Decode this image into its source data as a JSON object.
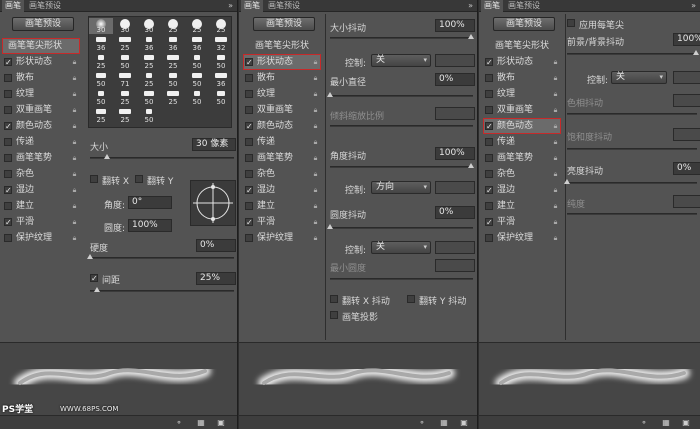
{
  "panel1": {
    "tabs": [
      "画笔",
      "画笔预设"
    ],
    "menu_icon": "»",
    "preset_button": "画笔预设",
    "list": [
      {
        "label": "画笔笔尖形状",
        "checked": false,
        "lock": false
      },
      {
        "label": "形状动态",
        "checked": true,
        "lock": true
      },
      {
        "label": "散布",
        "checked": false,
        "lock": true
      },
      {
        "label": "纹理",
        "checked": false,
        "lock": true
      },
      {
        "label": "双重画笔",
        "checked": false,
        "lock": true
      },
      {
        "label": "颜色动态",
        "checked": true,
        "lock": true
      },
      {
        "label": "传递",
        "checked": false,
        "lock": true
      },
      {
        "label": "画笔笔势",
        "checked": false,
        "lock": true
      },
      {
        "label": "杂色",
        "checked": false,
        "lock": true
      },
      {
        "label": "湿边",
        "checked": true,
        "lock": true
      },
      {
        "label": "建立",
        "checked": false,
        "lock": true
      },
      {
        "label": "平滑",
        "checked": true,
        "lock": true
      },
      {
        "label": "保护纹理",
        "checked": false,
        "lock": true
      }
    ],
    "brush_sizes": [
      "30",
      "30",
      "30",
      "25",
      "25",
      "25",
      "36",
      "25",
      "36",
      "36",
      "36",
      "32",
      "25",
      "50",
      "25",
      "25",
      "50",
      "50",
      "50",
      "71",
      "25",
      "50",
      "50",
      "36",
      "50",
      "25",
      "50",
      "25",
      "50",
      "50",
      "25",
      "25",
      "50"
    ],
    "size_label": "大小",
    "size_value": "30 像素",
    "flip_x_label": "翻转 X",
    "flip_y_label": "翻转 Y",
    "angle_label": "角度:",
    "angle_value": "0°",
    "roundness_label": "圆度:",
    "roundness_value": "100%",
    "hardness_label": "硬度",
    "hardness_value": "0%",
    "spacing_label": "间距",
    "spacing_value": "25%"
  },
  "panel2": {
    "tabs": [
      "画笔",
      "画笔预设"
    ],
    "menu_icon": "»",
    "preset_button": "画笔预设",
    "list": [
      {
        "label": "画笔笔尖形状",
        "checked": false,
        "lock": false
      },
      {
        "label": "形状动态",
        "checked": true,
        "lock": true
      },
      {
        "label": "散布",
        "checked": false,
        "lock": true
      },
      {
        "label": "纹理",
        "checked": false,
        "lock": true
      },
      {
        "label": "双重画笔",
        "checked": false,
        "lock": true
      },
      {
        "label": "颜色动态",
        "checked": true,
        "lock": true
      },
      {
        "label": "传递",
        "checked": false,
        "lock": true
      },
      {
        "label": "画笔笔势",
        "checked": false,
        "lock": true
      },
      {
        "label": "杂色",
        "checked": false,
        "lock": true
      },
      {
        "label": "湿边",
        "checked": true,
        "lock": true
      },
      {
        "label": "建立",
        "checked": false,
        "lock": true
      },
      {
        "label": "平滑",
        "checked": true,
        "lock": true
      },
      {
        "label": "保护纹理",
        "checked": false,
        "lock": true
      }
    ],
    "size_jitter_label": "大小抖动",
    "size_jitter_value": "100%",
    "control_label": "控制:",
    "control1_value": "关",
    "min_diameter_label": "最小直径",
    "min_diameter_value": "0%",
    "tilt_scale_label": "倾斜缩放比例",
    "angle_jitter_label": "角度抖动",
    "angle_jitter_value": "100%",
    "control2_value": "方向",
    "roundness_jitter_label": "圆度抖动",
    "roundness_jitter_value": "0%",
    "control3_value": "关",
    "min_roundness_label": "最小圆度",
    "flip_x_jitter_label": "翻转 X 抖动",
    "flip_y_jitter_label": "翻转 Y 抖动",
    "brush_projection_label": "画笔投影"
  },
  "panel3": {
    "tabs": [
      "画笔",
      "画笔预设"
    ],
    "menu_icon": "»",
    "preset_button": "画笔预设",
    "list": [
      {
        "label": "画笔笔尖形状",
        "checked": false,
        "lock": false
      },
      {
        "label": "形状动态",
        "checked": true,
        "lock": true
      },
      {
        "label": "散布",
        "checked": false,
        "lock": true
      },
      {
        "label": "纹理",
        "checked": false,
        "lock": true
      },
      {
        "label": "双重画笔",
        "checked": false,
        "lock": true
      },
      {
        "label": "颜色动态",
        "checked": true,
        "lock": true
      },
      {
        "label": "传递",
        "checked": false,
        "lock": true
      },
      {
        "label": "画笔笔势",
        "checked": false,
        "lock": true
      },
      {
        "label": "杂色",
        "checked": false,
        "lock": true
      },
      {
        "label": "湿边",
        "checked": true,
        "lock": true
      },
      {
        "label": "建立",
        "checked": false,
        "lock": true
      },
      {
        "label": "平滑",
        "checked": true,
        "lock": true
      },
      {
        "label": "保护纹理",
        "checked": false,
        "lock": true
      }
    ],
    "apply_per_tip_label": "应用每笔尖",
    "fg_bg_jitter_label": "前景/背景抖动",
    "fg_bg_jitter_value": "100%",
    "control_label": "控制:",
    "control_value": "关",
    "hue_jitter_label": "色相抖动",
    "saturation_jitter_label": "饱和度抖动",
    "brightness_jitter_label": "亮度抖动",
    "brightness_jitter_value": "0%",
    "purity_label": "纯度"
  },
  "watermark": {
    "main": "PS学堂",
    "url": "WWW.68PS.COM"
  },
  "colors": {
    "highlight": "#c62a2a",
    "panel_bg": "#535353"
  }
}
